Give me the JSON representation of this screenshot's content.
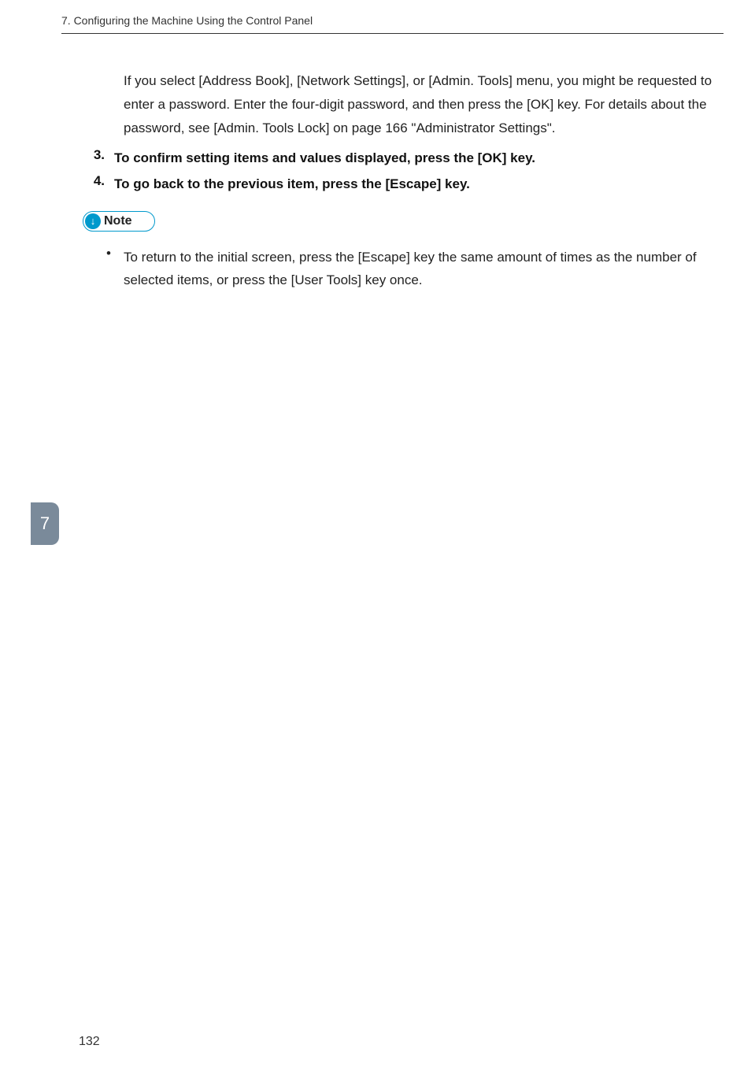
{
  "header": {
    "chapter_title": "7. Configuring the Machine Using the Control Panel"
  },
  "body": {
    "intro_paragraph": "If you select [Address Book], [Network Settings], or [Admin. Tools] menu, you might be requested to enter a password. Enter the four-digit password, and then press the [OK] key. For details about the password, see [Admin. Tools Lock] on page 166 \"Administrator Settings\"."
  },
  "steps": [
    {
      "num": "3.",
      "text": "To confirm setting items and values displayed, press the [OK] key."
    },
    {
      "num": "4.",
      "text": "To go back to the previous item, press the [Escape] key."
    }
  ],
  "note": {
    "label": "Note",
    "bullet": "To return to the initial screen, press the [Escape] key the same amount of times as the number of selected items, or press the [User Tools] key once."
  },
  "side_tab": {
    "number": "7"
  },
  "footer": {
    "page_number": "132"
  }
}
